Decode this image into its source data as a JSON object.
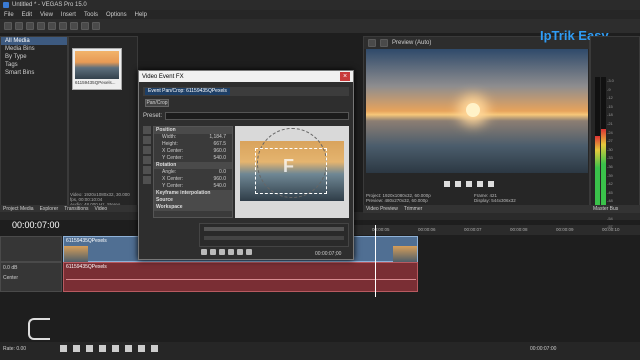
{
  "app": {
    "title": "Untitled * - VEGAS Pro 15.0"
  },
  "menu": [
    "File",
    "Edit",
    "View",
    "Insert",
    "Tools",
    "Options",
    "Help"
  ],
  "explorer": {
    "tree": [
      "All Media",
      "Media Bins",
      "By Type",
      "Tags",
      "Smart Bins"
    ],
    "thumb_caption": "61159435QPexels...",
    "info": [
      "Video: 1920x1080x32, 30.000 fps, 00:00:10:04",
      "Audio: 48,000 Hz, Stereo, 00:00:10:04"
    ],
    "tabs": [
      "Project Media",
      "Explorer",
      "Transitions",
      "Video"
    ]
  },
  "dialog": {
    "title": "Video Event FX",
    "chip": "Event Pan/Crop: 61159435QPexels",
    "pancrop_label": "Pan/Crop",
    "preset_label": "Preset:",
    "position_header": "Position",
    "props": [
      {
        "k": "Width:",
        "v": "1,184.7"
      },
      {
        "k": "Height:",
        "v": "667.5"
      },
      {
        "k": "X Center:",
        "v": "960.0"
      },
      {
        "k": "Y Center:",
        "v": "540.0"
      }
    ],
    "rotation_header": "Rotation",
    "rot_props": [
      {
        "k": "Angle:",
        "v": "0.0"
      },
      {
        "k": "X Center:",
        "v": "960.0"
      },
      {
        "k": "Y Center:",
        "v": "540.0"
      }
    ],
    "sections": [
      "Keyframe interpolation",
      "Source",
      "Workspace"
    ],
    "time": "00:00:07;00"
  },
  "preview": {
    "mode": "Preview (Auto)",
    "info_left": [
      "Project:  1920x1080x32, 60.000p",
      "Preview:  480x270x32, 60.000p"
    ],
    "info_right": [
      "Frame:  421",
      "Display:  544x306x32"
    ],
    "tabs": [
      "Video Preview",
      "Trimmer"
    ]
  },
  "watermark": "IpTrik Easy",
  "mixer": {
    "label": "Master Bus",
    "scale": [
      "-3.0",
      "-9",
      "-12",
      "-15",
      "-18",
      "-21",
      "-24",
      "-27",
      "-30",
      "-33",
      "-36",
      "-39",
      "-42",
      "-45",
      "-48",
      "-51",
      "-54",
      "-57"
    ],
    "left_level": 0.55,
    "right_level": 0.6,
    "bottom": "0.0"
  },
  "timeline": {
    "timecode": "00:00:07:00",
    "ruler": [
      "00:00:00",
      "00:00:01",
      "00:00:02",
      "00:00:03",
      "00:00:04",
      "00:00:05",
      "00:00:06",
      "00:00:07",
      "00:00:08",
      "00:00:09",
      "00:00:10"
    ],
    "video_clip": "61159435QPexels",
    "audio_clip": "61159435QPexels",
    "audio_vol": "0.0 dB",
    "audio_pan": "Center",
    "rate": "Rate: 0.00",
    "end_time": "00:00:07:00"
  }
}
